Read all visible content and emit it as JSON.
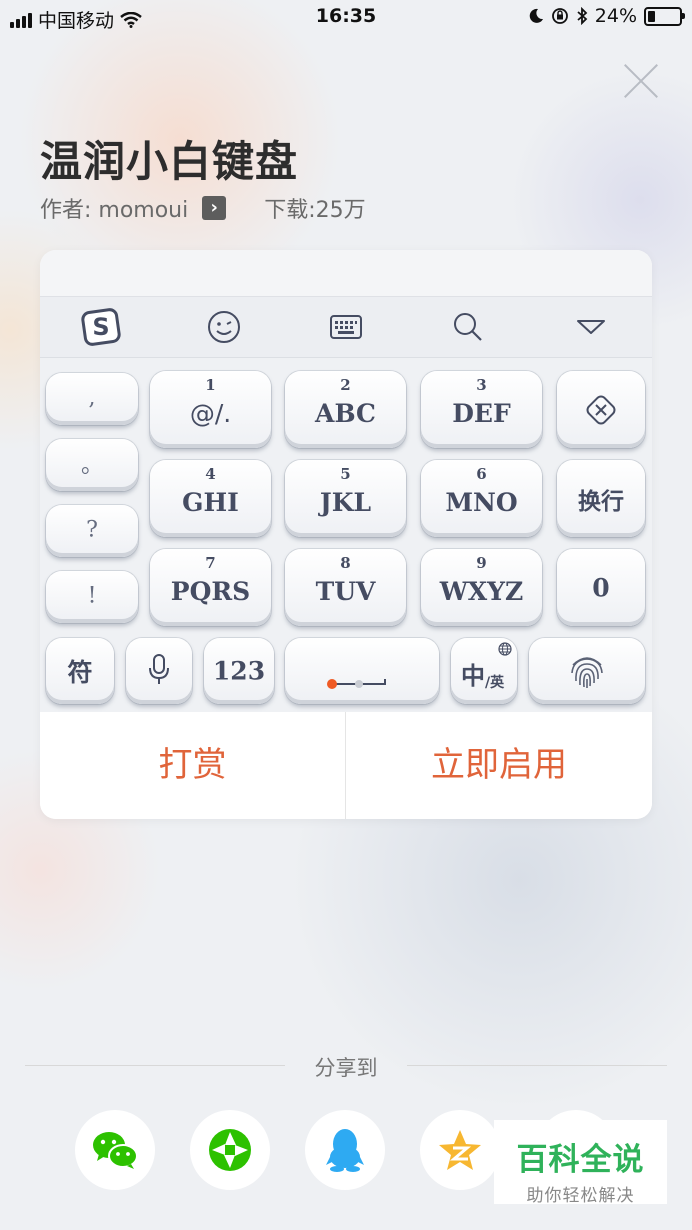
{
  "status_bar": {
    "carrier": "中国移动",
    "time": "16:35",
    "battery_text": "24%",
    "battery_level": 0.24
  },
  "header": {
    "title": "温润小白键盘",
    "author": "作者: momoui",
    "downloads": "下载:25万"
  },
  "keyboard": {
    "punct_keys": [
      ",",
      "。",
      "?",
      "!"
    ],
    "t9_keys": [
      {
        "num": "1",
        "label": "@/."
      },
      {
        "num": "2",
        "label": "ABC"
      },
      {
        "num": "3",
        "label": "DEF"
      },
      {
        "num": "4",
        "label": "GHI"
      },
      {
        "num": "5",
        "label": "JKL"
      },
      {
        "num": "6",
        "label": "MNO"
      },
      {
        "num": "7",
        "label": "PQRS"
      },
      {
        "num": "8",
        "label": "TUV"
      },
      {
        "num": "9",
        "label": "WXYZ"
      }
    ],
    "enter_label": "换行",
    "zero_label": "0",
    "symbols_label": "符",
    "numbers_label": "123",
    "lang_main": "中",
    "lang_sub": "/英"
  },
  "actions": {
    "tip": "打赏",
    "enable": "立即启用"
  },
  "share": {
    "title": "分享到"
  },
  "watermark": {
    "main": "百科全说",
    "sub": "助你轻松解决"
  },
  "colors": {
    "accent": "#e0643a",
    "key_text": "#454c62",
    "wechat": "#2dc100",
    "moments": "#2dc100",
    "qq": "#2eaaf2",
    "qzone": "#f7b731",
    "watermark": "#2fb25a"
  },
  "icons": [
    "signal-icon",
    "wifi-icon",
    "moon-icon",
    "orientation-lock-icon",
    "bluetooth-icon",
    "battery-icon",
    "close-icon",
    "arrow-right-icon",
    "sogou-logo-icon",
    "emoji-icon",
    "keyboard-icon",
    "search-icon",
    "collapse-icon",
    "backspace-icon",
    "mic-icon",
    "globe-icon",
    "fingerprint-icon",
    "wechat-icon",
    "moments-icon",
    "qq-icon",
    "qzone-icon"
  ]
}
